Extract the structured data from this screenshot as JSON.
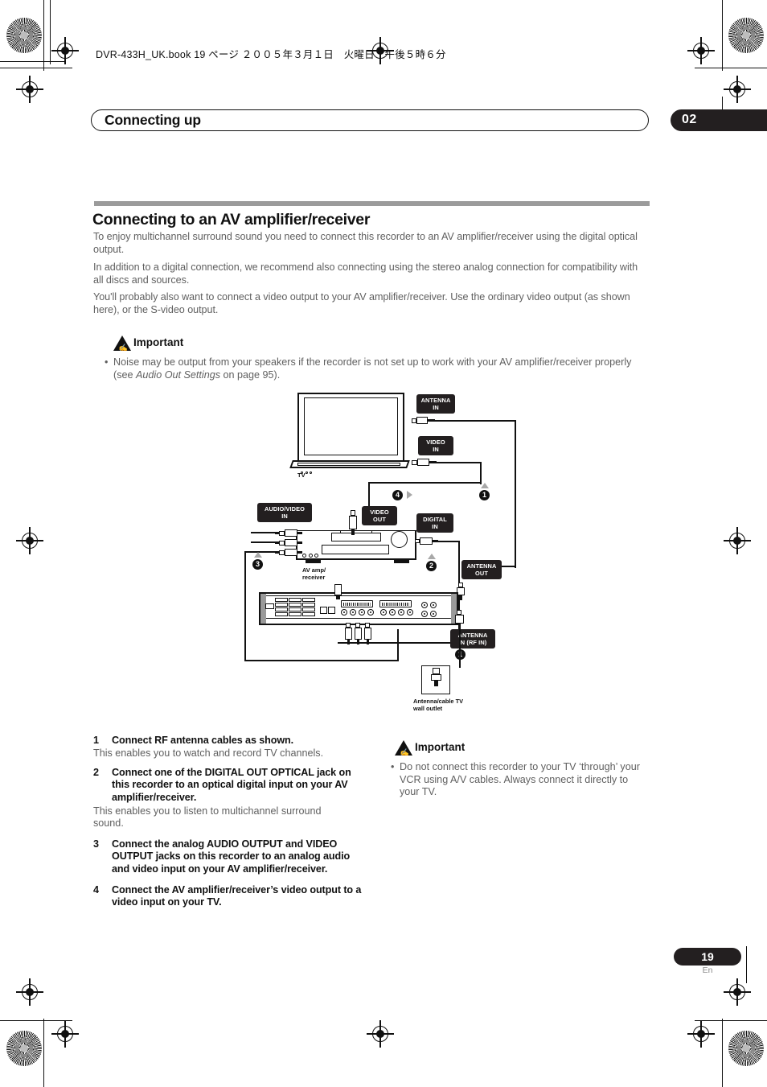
{
  "header": {
    "book_line": "DVR-433H_UK.book  19 ページ  ２００５年３月１日　火曜日　午後５時６分",
    "chapter_title": "Connecting up",
    "chapter_number": "02"
  },
  "section": {
    "heading": "Connecting to an AV amplifier/receiver",
    "paragraphs": [
      "To enjoy multichannel surround sound you need to connect this recorder to an AV amplifier/receiver using the digital optical output.",
      "In addition to a digital connection, we recommend also connecting using the stereo analog connection for compatibility with all discs and sources.",
      "You'll probably also want to connect a video output to your AV amplifier/receiver. Use the ordinary video output (as shown here), or the S-video output."
    ]
  },
  "important_top": {
    "label": "Important",
    "bullet_prefix": "Noise may be output from your speakers if the recorder is not set up to work with your AV amplifier/receiver properly (see ",
    "bullet_italic": "Audio Out Settings",
    "bullet_suffix": " on page 95)."
  },
  "important_bottom": {
    "label": "Important",
    "bullet": "Do not connect this recorder to your TV ‘through’ your VCR using A/V cables. Always connect it directly to your TV."
  },
  "diagram": {
    "tv_label": "TV",
    "amp_label_line1": "AV amp/",
    "amp_label_line2": "receiver",
    "outlet_label_line1": "Antenna/cable TV",
    "outlet_label_line2": "wall outlet",
    "jacks": {
      "antenna_in": "ANTENNA\nIN",
      "video_in": "VIDEO\nIN",
      "audio_video_in": "AUDIO/VIDEO\nIN",
      "video_out": "VIDEO\nOUT",
      "digital_in": "DIGITAL\nIN",
      "antenna_out": "ANTENNA\nOUT",
      "antenna_in_rf": "ANTENNA\nIN (RF IN)"
    },
    "callouts": [
      "1",
      "2",
      "3",
      "4",
      "1"
    ]
  },
  "steps": [
    {
      "number": "1",
      "title": "Connect RF antenna cables as shown.",
      "desc": "This enables you to watch and record TV channels."
    },
    {
      "number": "2",
      "title": "Connect one of the DIGITAL OUT OPTICAL jack on this recorder to an optical digital input on your AV amplifier/receiver.",
      "desc": "This enables you to listen to multichannel surround sound."
    },
    {
      "number": "3",
      "title": "Connect the analog AUDIO OUTPUT and VIDEO OUTPUT jacks on this recorder to an analog audio and video input on your AV amplifier/receiver.",
      "desc": ""
    },
    {
      "number": "4",
      "title": "Connect the AV amplifier/receiver’s video output to a video input on your TV.",
      "desc": ""
    }
  ],
  "footer": {
    "page_number": "19",
    "language": "En"
  },
  "colors": {
    "ink": "#111111",
    "body_gray": "#5f5f5f",
    "rule_gray": "#9b9b9b",
    "tab_black": "#231f20",
    "arrow_gray": "#a8a8a8"
  }
}
